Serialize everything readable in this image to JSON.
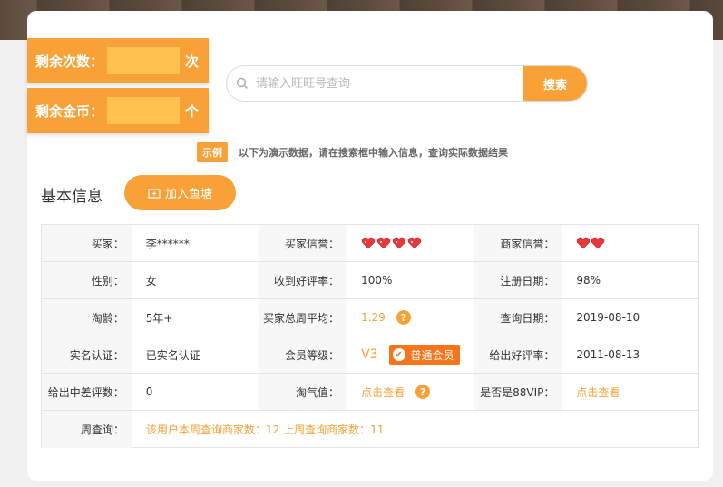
{
  "counters": {
    "remaining_times_label": "剩余次数：",
    "remaining_times_unit": "次",
    "remaining_coins_label": "剩余金币：",
    "remaining_coins_unit": "个"
  },
  "search": {
    "placeholder": "请输入旺旺号查询",
    "button": "搜索"
  },
  "demo": {
    "tag": "示例",
    "note": "以下为演示数据，请在搜索框中输入信息，查询实际数据结果"
  },
  "section": {
    "title": "基本信息",
    "join_button": "加入鱼塘"
  },
  "info": {
    "buyer_label": "买家：",
    "buyer_value": "李******",
    "buyer_credit_label": "买家信誉：",
    "seller_credit_label": "商家信誉：",
    "gender_label": "性别：",
    "gender_value": "女",
    "good_rate_received_label": "收到好评率：",
    "good_rate_received_value": "100%",
    "register_date_label": "注册日期：",
    "register_date_value": "98%",
    "age_label": "淘龄：",
    "age_value": "5年+",
    "weekly_avg_label": "买家总周平均：",
    "weekly_avg_value": "1.29",
    "query_date_label": "查询日期：",
    "query_date_value": "2019-08-10",
    "realname_label": "实名认证：",
    "realname_value": "已实名认证",
    "member_level_label": "会员等级：",
    "member_level_value": "V3",
    "member_badge": "普通会员",
    "good_rate_given_label": "给出好评率：",
    "good_rate_given_value": "2011-08-13",
    "mid_bad_given_label": "给出中差评数：",
    "mid_bad_given_value": "0",
    "taoqi_label": "淘气值：",
    "taoqi_value": "点击查看",
    "vip88_label": "是否是88VIP：",
    "vip88_value": "点击查看",
    "weekly_query_label": "周查询：",
    "weekly_query_value": "该用户本周查询商家数：12 上周查询商家数：11"
  },
  "icons": {
    "help": "?",
    "badge_check": "✔"
  },
  "colors": {
    "accent": "#f7a136",
    "slot": "#ffc14f",
    "heart": "#e8383d",
    "member_badge": "#f5761a"
  }
}
